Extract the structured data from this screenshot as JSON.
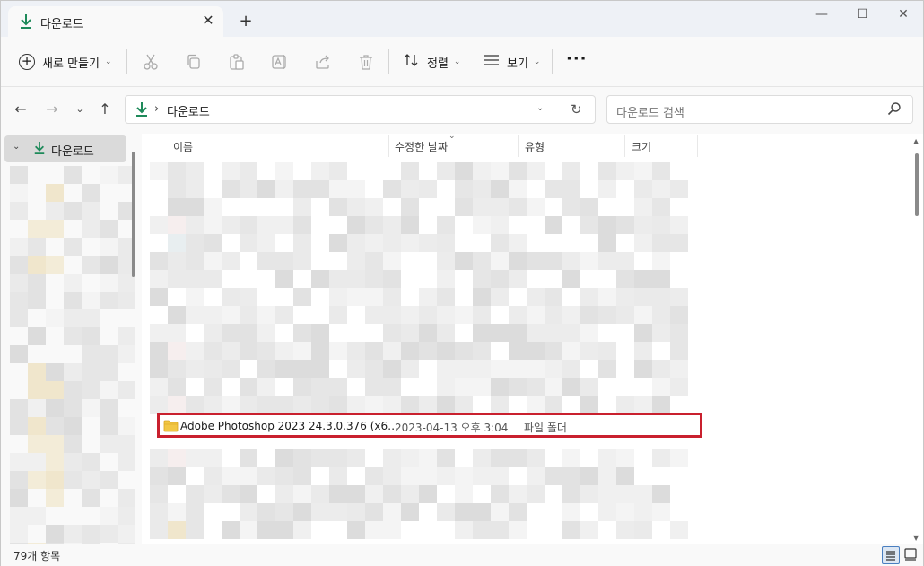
{
  "tab": {
    "title": "다운로드",
    "close": "✕",
    "new_tab": "+"
  },
  "window_controls": {
    "minimize": "—",
    "maximize": "☐",
    "close": "✕"
  },
  "toolbar": {
    "new_label": "새로 만들기",
    "sort_label": "정렬",
    "view_label": "보기",
    "more_label": "···",
    "icons": [
      "cut-icon",
      "copy-icon",
      "paste-icon",
      "rename-icon",
      "share-icon",
      "delete-icon"
    ]
  },
  "address": {
    "breadcrumb_sep": "›",
    "breadcrumb": "다운로드",
    "search_placeholder": "다운로드 검색"
  },
  "sidebar": {
    "selected_label": "다운로드"
  },
  "columns": {
    "name": "이름",
    "modified": "수정한 날짜",
    "type": "유형",
    "size": "크기"
  },
  "highlighted_row": {
    "name": "Adobe Photoshop 2023 24.3.0.376 (x6…",
    "modified": "2023-04-13 오후 3:04",
    "type": "파일 폴더"
  },
  "status": {
    "item_count": "79개 항목"
  },
  "colors": {
    "highlight_border": "#c9202e",
    "download_green": "#1e8a5a",
    "folder_yellow": "#f2c744"
  }
}
